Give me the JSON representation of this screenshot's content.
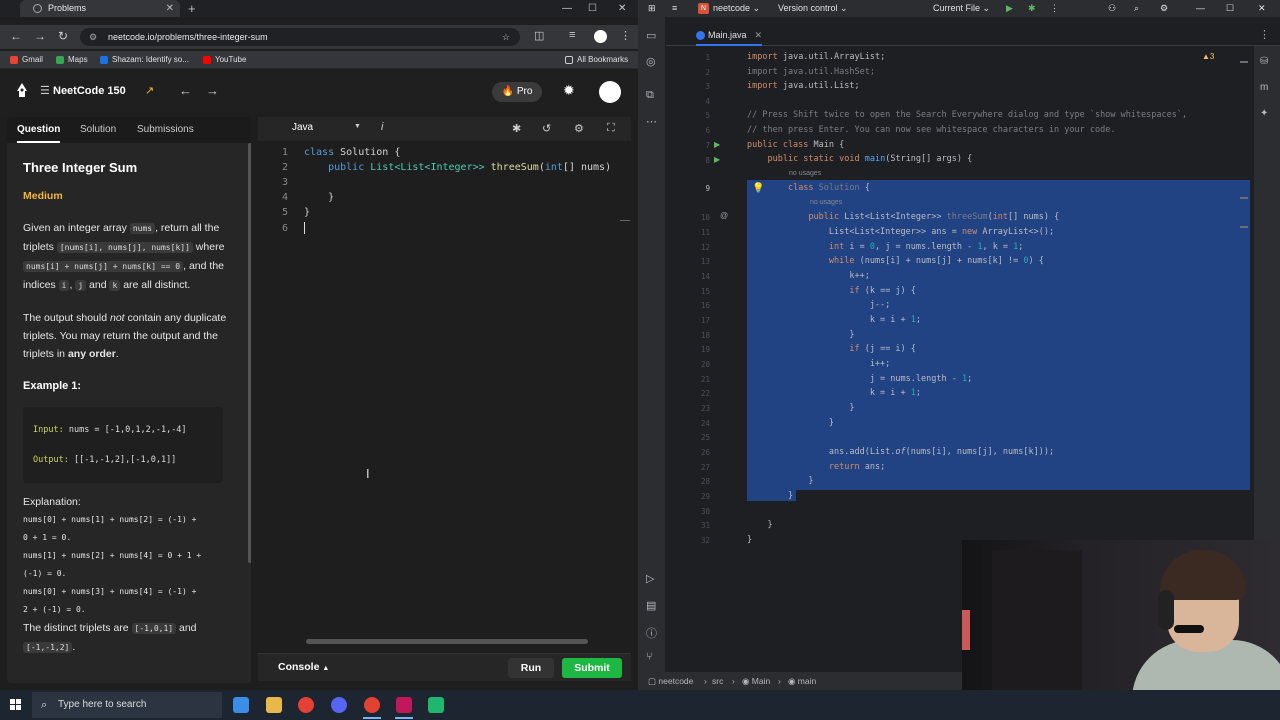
{
  "browser": {
    "tab_title": "Problems",
    "url": "neetcode.io/problems/three-integer-sum",
    "bookmarks": [
      {
        "label": "Gmail",
        "color": "#ea4335"
      },
      {
        "label": "Maps",
        "color": "#34a853"
      },
      {
        "label": "Shazam: Identify so...",
        "color": "#1a73e8"
      },
      {
        "label": "YouTube",
        "color": "#ff0000"
      }
    ],
    "all_bookmarks": "All Bookmarks"
  },
  "neetcode": {
    "course": "NeetCode 150",
    "pro_label": "Pro",
    "tabs": [
      "Question",
      "Solution",
      "Submissions"
    ],
    "problem": {
      "title": "Three Integer Sum",
      "difficulty": "Medium",
      "para1_a": "Given an integer array ",
      "para1_code1": "nums",
      "para1_b": ", return all the triplets ",
      "para1_code2": "[nums[i], nums[j], nums[k]]",
      "para1_c": " where ",
      "para1_code3": "nums[i] + nums[j] + nums[k] == 0",
      "para1_d": ", and the indices ",
      "para1_code4": "i",
      "para1_e": ", ",
      "para1_code5": "j",
      "para1_f": " and ",
      "para1_code6": "k",
      "para1_g": " are all distinct.",
      "para2_a": "The output should ",
      "para2_em": "not",
      "para2_b": " contain any duplicate triplets. You may return the output and the triplets in ",
      "para2_strong": "any order",
      "para2_c": ".",
      "example_heading": "Example 1:",
      "input_label": "Input:",
      "input_value": "nums = [-1,0,1,2,-1,-4]",
      "output_label": "Output:",
      "output_value": "[[-1,-1,2],[-1,0,1]]",
      "explanation_heading": "Explanation:",
      "explanation_lines": [
        "nums[0] + nums[1] + nums[2] = (-1) +",
        "0 + 1 = 0.",
        "nums[1] + nums[2] + nums[4] = 0 + 1 +",
        "(-1) = 0.",
        "nums[0] + nums[3] + nums[4] = (-1) +",
        "2 + (-1) = 0."
      ],
      "distinct_a": "The distinct triplets are ",
      "distinct_code1": "[-1,0,1]",
      "distinct_b": " and",
      "distinct_code2": "[-1,-1,2]",
      "distinct_c": "."
    },
    "editor": {
      "language": "Java",
      "lines": [
        {
          "n": "1",
          "text": ""
        },
        {
          "n": "2",
          "text": ""
        },
        {
          "n": "3",
          "text": ""
        },
        {
          "n": "4",
          "text": ""
        },
        {
          "n": "5",
          "text": "}"
        },
        {
          "n": "6",
          "text": ""
        }
      ],
      "line1": {
        "kw": "class",
        "name": " Solution {"
      },
      "line2": {
        "kw": "public",
        "t1": " List<List<Integer>> ",
        "fn": "threeSum",
        "rest": "(",
        "kw2": "int",
        "rest2": "[] nums)"
      },
      "line4": "}"
    },
    "console_label": "Console",
    "run_label": "Run",
    "submit_label": "Submit"
  },
  "ide": {
    "project": "neetcode",
    "project_badge": "N",
    "vcs": "Version control",
    "run_config": "Current File",
    "file_tab": "Main.java",
    "warning_count": "3",
    "hints": {
      "no_usages": "no usages"
    },
    "status_breadcrumb": [
      "neetcode",
      "src",
      "Main",
      "main"
    ],
    "gutter_numbers": [
      "1",
      "2",
      "3",
      "4",
      "5",
      "6",
      "7",
      "8",
      "9",
      "10",
      "11",
      "12",
      "13",
      "14",
      "15",
      "16",
      "17",
      "18",
      "19",
      "20",
      "21",
      "22",
      "23",
      "24",
      "25",
      "26",
      "27",
      "28",
      "29",
      "30",
      "31",
      "32"
    ]
  },
  "taskbar": {
    "search_placeholder": "Type here to search"
  }
}
